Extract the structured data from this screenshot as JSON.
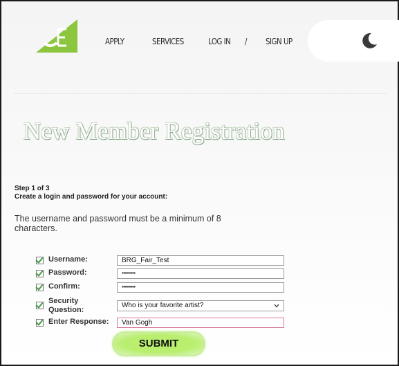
{
  "header": {
    "logo_text": "OE",
    "nav": {
      "apply": "APPLY",
      "services": "SERVICES",
      "login": "LOG IN",
      "separator": "/",
      "signup": "SIGN UP"
    },
    "theme_toggle_icon": "moon-icon"
  },
  "page": {
    "title": "New Member Registration",
    "step_label": "Step 1 of 3",
    "step_description": "Create a login and password for your account:",
    "requirements_note": "The username and password must be a minimum of 8 characters."
  },
  "form": {
    "username": {
      "label": "Username:",
      "value": "BRG_Fair_Test"
    },
    "password": {
      "label": "Password:",
      "value": "••••••••••"
    },
    "confirm": {
      "label": "Confirm:",
      "value": "••••••••••"
    },
    "security_question": {
      "label": "Security Question:",
      "value": "Who is your favorite artist?"
    },
    "response": {
      "label": "Enter Response:",
      "value": "Van Gogh"
    },
    "submit_label": "SUBMIT"
  },
  "colors": {
    "accent_green": "#b9ee6e",
    "logo_green": "#8cc63f",
    "check_green": "#3f9a3a",
    "response_border": "#d6739b"
  }
}
